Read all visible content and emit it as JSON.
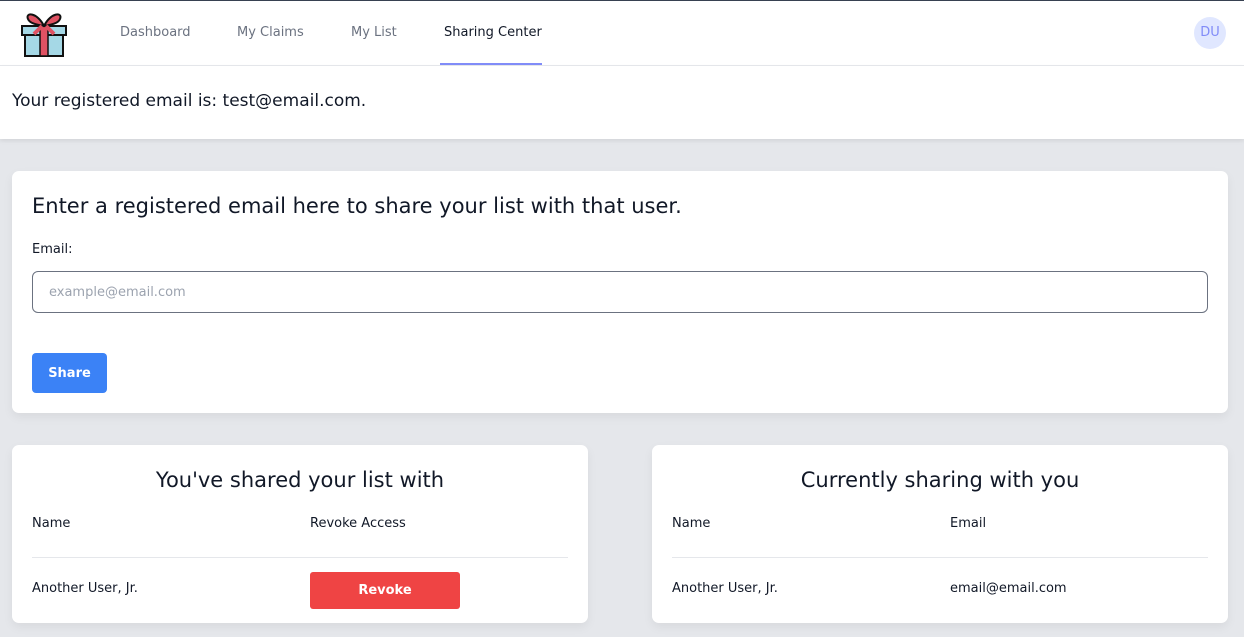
{
  "nav": {
    "items": [
      {
        "label": "Dashboard"
      },
      {
        "label": "My Claims"
      },
      {
        "label": "My List"
      },
      {
        "label": "Sharing Center"
      }
    ],
    "active": "Sharing Center",
    "avatar_initials": "DU",
    "logo_icon": "gift-icon",
    "accent_color": "#818cf8"
  },
  "registered": {
    "text": "Your registered email is: test@email.com."
  },
  "share_form": {
    "heading": "Enter a registered email here to share your list with that user.",
    "email_label": "Email:",
    "email_placeholder": "example@email.com",
    "email_value": "",
    "share_label": "Share",
    "share_color": "#3b82f6"
  },
  "shared_with": {
    "title": "You've shared your list with",
    "columns": [
      "Name",
      "Revoke Access"
    ],
    "rows": [
      {
        "name": "Another User, Jr.",
        "action_label": "Revoke"
      }
    ],
    "revoke_color": "#ef4444"
  },
  "sharing_with_you": {
    "title": "Currently sharing with you",
    "columns": [
      "Name",
      "Email"
    ],
    "rows": [
      {
        "name": "Another User, Jr.",
        "email": "email@email.com"
      }
    ]
  }
}
